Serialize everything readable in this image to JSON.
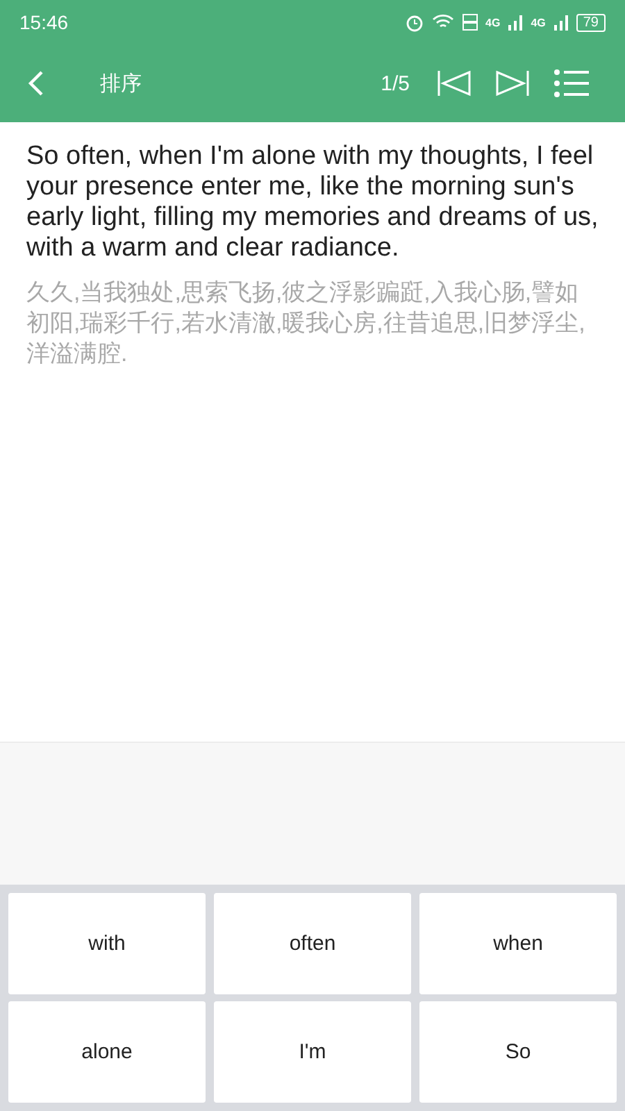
{
  "status_bar": {
    "time": "15:46",
    "network_labels": [
      "4G",
      "4G"
    ],
    "battery": "79"
  },
  "toolbar": {
    "title": "排序",
    "progress": "1/5"
  },
  "sentence": {
    "english": "So often, when I'm alone with my thoughts, I feel your presence enter me, like the morning sun's early light, filling my memories and dreams of us, with a warm and clear radiance.",
    "chinese": "久久,当我独处,思索飞扬,彼之浮影蹁跹,入我心肠,譬如初阳,瑞彩千行,若水清澈,暖我心房,往昔追思,旧梦浮尘,洋溢满腔."
  },
  "word_tiles": [
    "with",
    "often",
    "when",
    "alone",
    "I'm",
    "So"
  ]
}
